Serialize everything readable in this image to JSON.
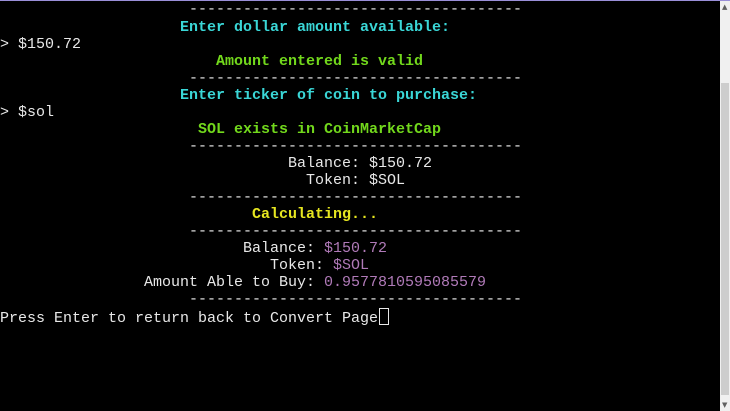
{
  "terminal": {
    "divider": "-------------------------------------",
    "prompt_amount": "Enter dollar amount available:",
    "input_amount": "> $150.72",
    "amount_valid": "Amount entered is valid",
    "prompt_ticker": "Enter ticker of coin to purchase:",
    "input_ticker": "> $sol",
    "ticker_valid": "SOL exists in CoinMarketCap",
    "summary_balance": "Balance: $150.72",
    "summary_token": "Token: $SOL",
    "calculating": "Calculating...",
    "result_balance_label": "Balance: ",
    "result_balance_value": "$150.72",
    "result_token_label": "Token: ",
    "result_token_value": "$SOL",
    "result_amount_label": "Amount Able to Buy: ",
    "result_amount_value": "0.9577810595085579",
    "press_enter": "Press Enter to return back to Convert Page"
  },
  "colors": {
    "prompt": "#3ad6d6",
    "success": "#72d81c",
    "status": "#e6e620",
    "value": "#b07ab8"
  }
}
